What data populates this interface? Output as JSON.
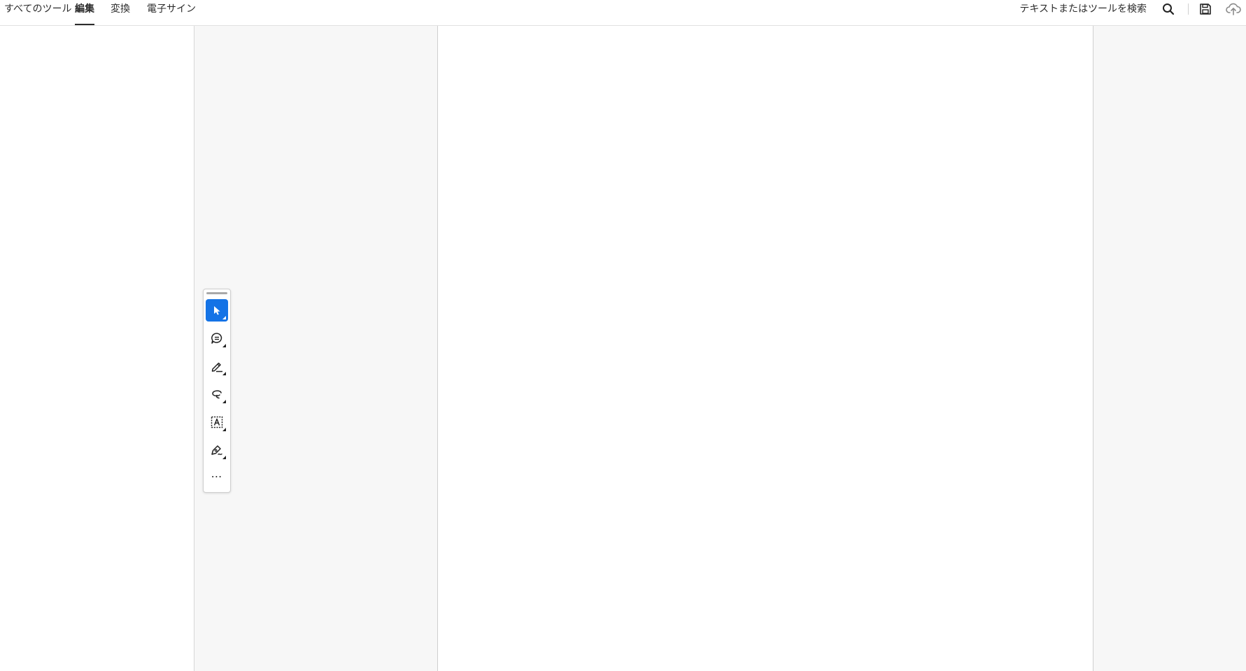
{
  "nav": {
    "tabs": [
      {
        "label": "すべてのツール",
        "active": false
      },
      {
        "label": "編集",
        "active": true
      },
      {
        "label": "変換",
        "active": false
      },
      {
        "label": "電子サイン",
        "active": false
      }
    ],
    "search_label": "テキストまたはツールを検索",
    "icons": [
      "search-icon",
      "save-icon",
      "cloud-upload-icon"
    ]
  },
  "quick_tools": [
    {
      "name": "select-tool",
      "icon": "cursor-arrow-icon",
      "selected": true
    },
    {
      "name": "comment-tool",
      "icon": "comment-bubble-icon",
      "selected": false
    },
    {
      "name": "highlight-tool",
      "icon": "highlighter-pen-icon",
      "selected": false
    },
    {
      "name": "draw-tool",
      "icon": "freehand-lasso-icon",
      "selected": false
    },
    {
      "name": "text-box-tool",
      "icon": "text-box-icon",
      "selected": false
    },
    {
      "name": "sign-tool",
      "icon": "signature-pen-icon",
      "selected": false
    },
    {
      "name": "more-tools",
      "icon": "more-horizontal-icon",
      "selected": false
    }
  ],
  "colors": {
    "accent": "#1473e6",
    "viewer_background": "#f7f7f7",
    "page_background": "#ffffff"
  }
}
